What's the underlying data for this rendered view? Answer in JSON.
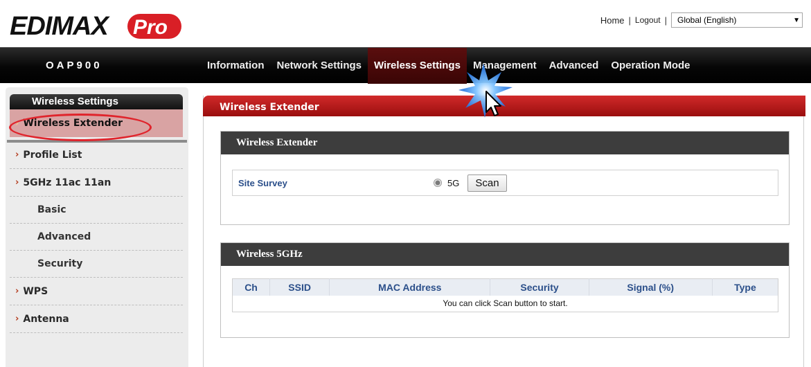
{
  "header": {
    "brand": "EDIMAX Pro",
    "links": {
      "home": "Home",
      "logout": "Logout"
    },
    "language": "Global (English)"
  },
  "navbar": {
    "model": "OAP900",
    "menu": [
      "Information",
      "Network Settings",
      "Wireless Settings",
      "Management",
      "Advanced",
      "Operation Mode"
    ],
    "active": "Wireless Settings"
  },
  "sidebar": {
    "title": "Wireless Settings",
    "items": [
      {
        "label": "Wireless Extender",
        "active": true
      },
      {
        "label": "Profile List"
      },
      {
        "label": "5GHz 11ac 11an"
      },
      {
        "label": "Basic"
      },
      {
        "label": "Advanced"
      },
      {
        "label": "Security"
      },
      {
        "label": "WPS"
      },
      {
        "label": "Antenna"
      }
    ]
  },
  "main": {
    "title": "Wireless Extender",
    "extender_panel": {
      "title": "Wireless Extender",
      "site_survey_label": "Site Survey",
      "band_label": "5G",
      "scan_button": "Scan"
    },
    "wireless_panel": {
      "title": "Wireless 5GHz",
      "columns": [
        "Ch",
        "SSID",
        "MAC Address",
        "Security",
        "Signal (%)",
        "Type"
      ],
      "empty_message": "You can click Scan button to start."
    }
  },
  "colors": {
    "accent_red": "#b81414",
    "nav_black": "#000000",
    "label_blue": "#2b4f8a"
  }
}
